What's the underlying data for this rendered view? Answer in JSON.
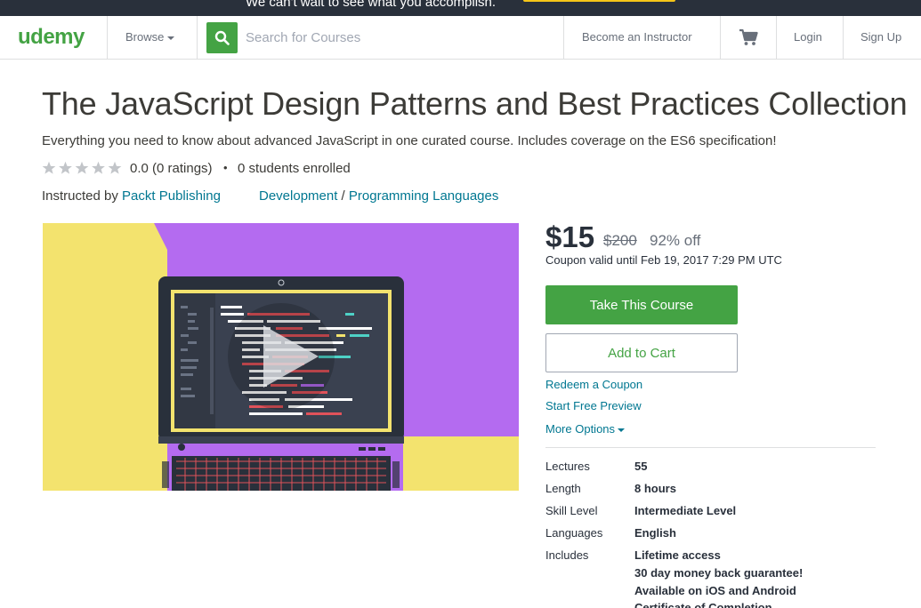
{
  "banner": {
    "text": "We can't wait to see what you accomplish."
  },
  "header": {
    "logo": "udemy",
    "browse": "Browse",
    "search_placeholder": "Search for Courses",
    "become_instructor": "Become an Instructor",
    "login": "Login",
    "signup": "Sign Up"
  },
  "course": {
    "title": "The JavaScript Design Patterns and Best Practices Collection",
    "subtitle": "Everything you need to know about advanced JavaScript in one curated course. Includes coverage on the ES6 specification!",
    "rating_value": 0.0,
    "rating_text": "0.0 (0 ratings)",
    "separator": "•",
    "students": "0 students enrolled",
    "instructed_by_prefix": "Instructed by ",
    "instructor": "Packt Publishing",
    "category": "Development",
    "category_sep": " / ",
    "subcategory": "Programming Languages"
  },
  "purchase": {
    "price": "$15",
    "original_price": "$200",
    "discount": "92% off",
    "coupon": "Coupon valid until Feb 19, 2017 7:29 PM UTC",
    "take_course": "Take This Course",
    "add_to_cart": "Add to Cart",
    "redeem": "Redeem a Coupon",
    "preview": "Start Free Preview",
    "more_options": "More Options"
  },
  "specs": [
    {
      "label": "Lectures",
      "value": "55"
    },
    {
      "label": "Length",
      "value": "8 hours"
    },
    {
      "label": "Skill Level",
      "value": "Intermediate Level"
    },
    {
      "label": "Languages",
      "value": "English"
    },
    {
      "label": "Includes",
      "value": "Lifetime access"
    }
  ],
  "includes_extra": [
    "30 day money back guarantee!",
    "Available on iOS and Android",
    "Certificate of Completion"
  ],
  "colors": {
    "brand_green": "#44a344",
    "link_blue": "#007791",
    "dark": "#29303b",
    "video_yellow": "#f3e36e",
    "video_purple": "#b46bf0"
  }
}
